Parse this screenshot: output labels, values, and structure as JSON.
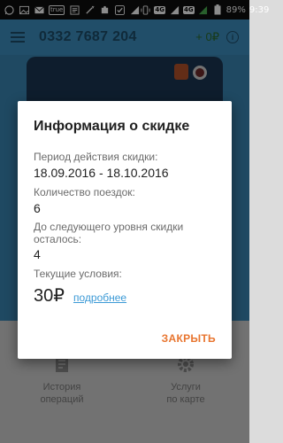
{
  "status_bar": {
    "icons_left": [
      "whatsapp-icon",
      "image-icon",
      "mail-icon",
      "true-badge",
      "clipboard-icon",
      "wand-icon",
      "puzzle-icon",
      "check-icon",
      "signal-icon"
    ],
    "true_badge": "true",
    "network": "4G",
    "network_alt": "4G",
    "battery": "89%",
    "time": "9:39"
  },
  "app": {
    "phone": "0332 7687 204",
    "balance": "+ 0₽",
    "bottom_nav": [
      {
        "label": "История\nопераций",
        "icon": "document-icon"
      },
      {
        "label": "Услуги\nпо карте",
        "icon": "gear-icon"
      }
    ]
  },
  "dialog": {
    "title": "Информация о скидке",
    "period_label": "Период действия скидки:",
    "period_value": "18.09.2016 - 18.10.2016",
    "trips_label": "Количество поездок:",
    "trips_value": "6",
    "next_label": "До следующего уровня скидки осталось:",
    "next_value": "4",
    "current_label": "Текущие условия:",
    "current_price": "30₽",
    "more_link": "подробнее",
    "close_button": "ЗАКРЫТЬ"
  },
  "colors": {
    "accent": "#e8752f",
    "link": "#3c9ad6",
    "header": "#3d8fbf"
  }
}
